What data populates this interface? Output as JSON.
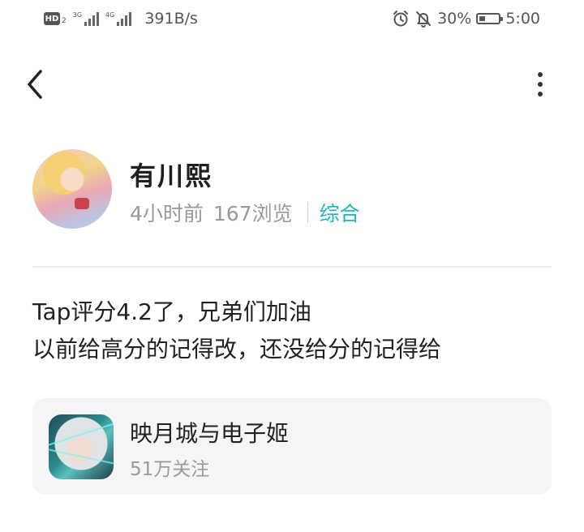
{
  "status_bar": {
    "hd_label": "HD",
    "hd_sub": "2",
    "sim1_network": "3G",
    "sim2_network": "4G",
    "net_speed": "391B/s",
    "battery_percent_text": "30%",
    "battery_level": 0.3,
    "time": "5:00",
    "icons": [
      "alarm-icon",
      "mute-bell-icon",
      "battery-icon"
    ]
  },
  "nav": {
    "back_icon": "chevron-left-icon",
    "more_icon": "more-vertical-icon"
  },
  "author": {
    "name": "有川熙",
    "time_ago": "4小时前",
    "views": "167浏览",
    "category": "综合"
  },
  "post": {
    "lines": [
      "Tap评分4.2了，兄弟们加油",
      "以前给高分的记得改，还没给分的记得给"
    ]
  },
  "game_card": {
    "title": "映月城与电子姬",
    "followers": "51万关注"
  },
  "colors": {
    "accent": "#1fb6b9",
    "text_primary": "#222222",
    "text_secondary": "#9a9a9a",
    "card_bg": "#f5f5f5"
  }
}
